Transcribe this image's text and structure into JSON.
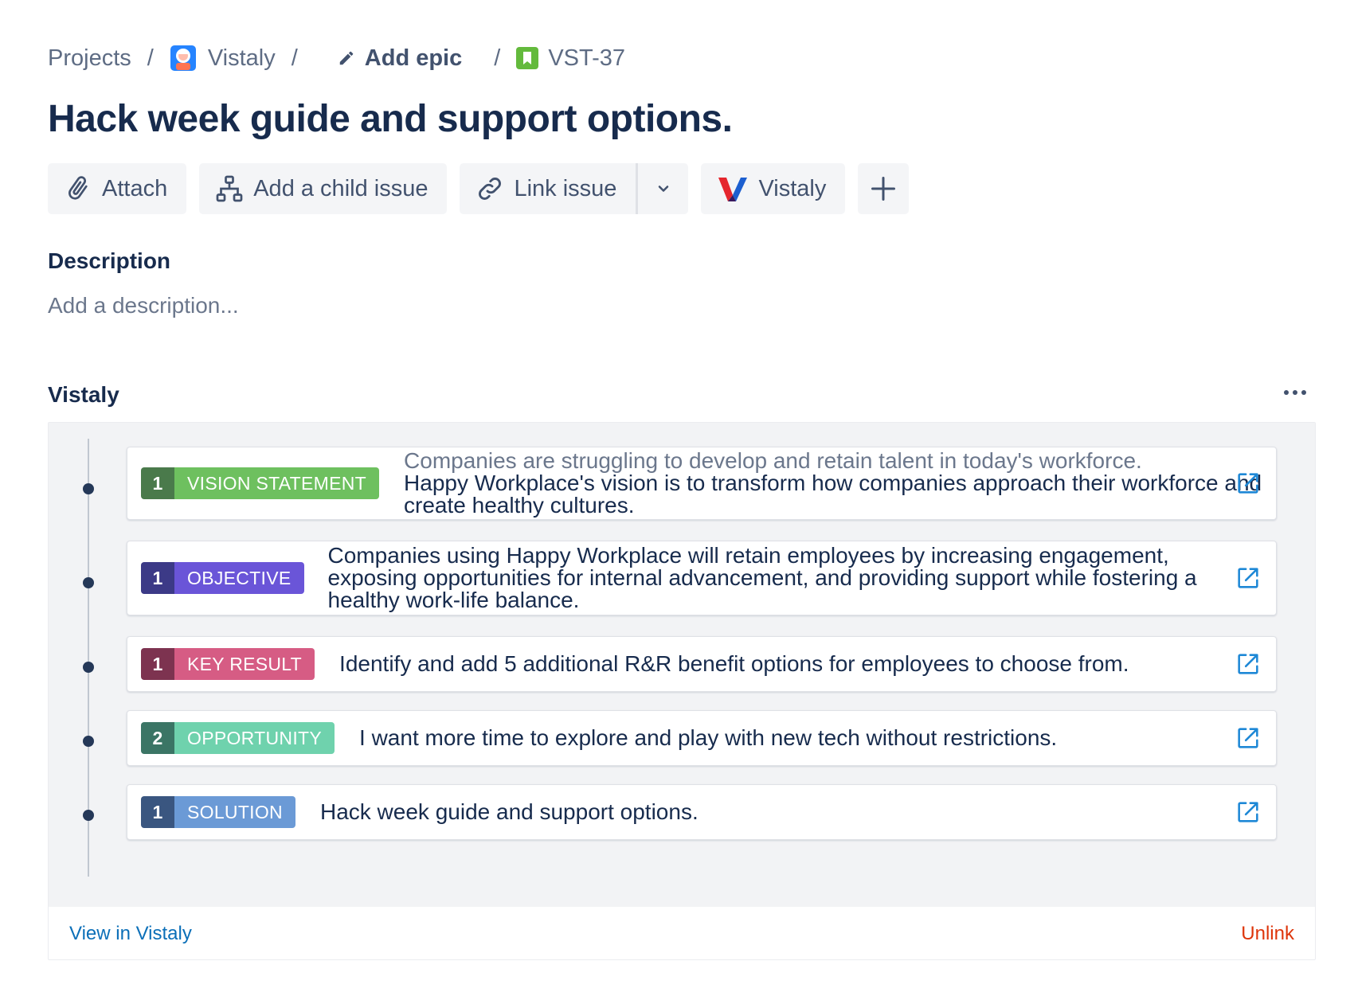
{
  "breadcrumb": {
    "projects": "Projects",
    "project_name": "Vistaly",
    "epic": "Add epic",
    "issue_key": "VST-37",
    "separator": "/"
  },
  "issue": {
    "title": "Hack week guide and support options."
  },
  "toolbar": {
    "attach": "Attach",
    "add_child": "Add a child issue",
    "link_issue": "Link issue",
    "vistaly": "Vistaly"
  },
  "description": {
    "heading": "Description",
    "placeholder": "Add a description..."
  },
  "vistaly_panel": {
    "heading": "Vistaly",
    "items": [
      {
        "number": "1",
        "type": "VISION STATEMENT",
        "num_color": "#4a7a4b",
        "label_color": "#6ec05f",
        "text_muted": "Companies are struggling to develop and retain talent in today's workforce.",
        "text": "Happy Workplace's vision is to transform how companies approach their workforce and create healthy cultures."
      },
      {
        "number": "1",
        "type": "OBJECTIVE",
        "num_color": "#3c3a87",
        "label_color": "#6a55d8",
        "text": "Companies using Happy Workplace will retain employees by increasing engagement, exposing opportunities for internal advancement, and providing support while fostering a healthy work-life balance."
      },
      {
        "number": "1",
        "type": "KEY RESULT",
        "num_color": "#7d3350",
        "label_color": "#d65c84",
        "text": "Identify and add 5 additional R&R benefit options for employees to choose from."
      },
      {
        "number": "2",
        "type": "OPPORTUNITY",
        "num_color": "#3b7565",
        "label_color": "#6fd2ad",
        "text": "I want more time to explore and play with new tech without restrictions."
      },
      {
        "number": "1",
        "type": "SOLUTION",
        "num_color": "#3a5680",
        "label_color": "#6b9ad6",
        "text": "Hack week guide and support options."
      }
    ],
    "view_link": "View in Vistaly",
    "unlink": "Unlink"
  },
  "icons": {
    "attach": "paperclip-icon",
    "child": "hierarchy-icon",
    "link": "link-icon",
    "caret": "chevron-down-icon",
    "plus": "plus-icon",
    "more": "more-icon",
    "open": "external-link-icon",
    "edit": "pencil-icon",
    "story": "story-bookmark-icon"
  },
  "colors": {
    "text_primary": "#172b4d",
    "text_subtle": "#5e6c84",
    "link": "#0b6fb8",
    "danger": "#de350b",
    "external_icon": "#1e88d6"
  }
}
